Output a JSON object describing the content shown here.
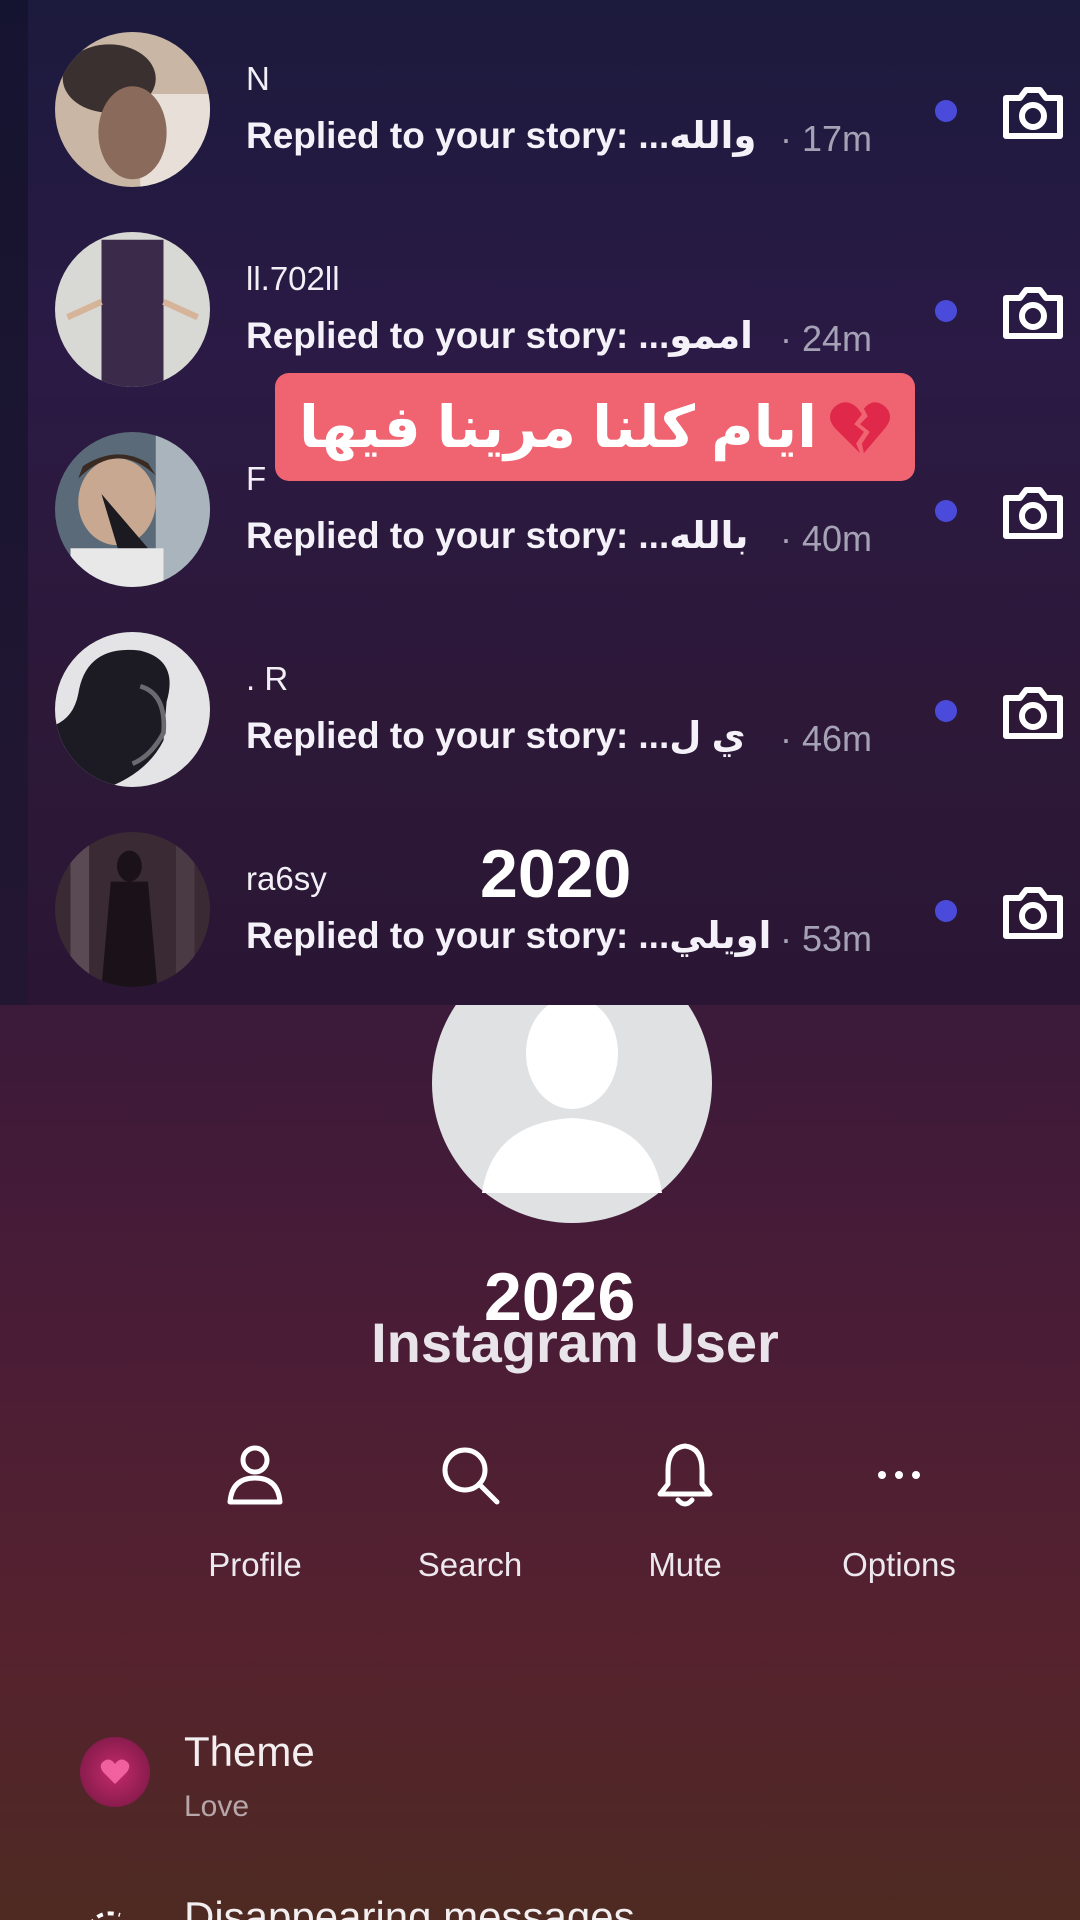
{
  "banner": {
    "text": "ايام كلنا مرينا فيها"
  },
  "year_top": "2020",
  "year_bottom": "2026",
  "threads": [
    {
      "name": "N",
      "preview_prefix": "Replied to your story:",
      "preview_text": "والله...",
      "time": "· 17m"
    },
    {
      "name": "ll.702ll",
      "preview_prefix": "Replied to your story:",
      "preview_text": "اممو...",
      "time": "· 24m"
    },
    {
      "name": "F",
      "preview_prefix": "Replied to your story:",
      "preview_text": "بالله...",
      "time": "· 40m"
    },
    {
      "name": ". R",
      "preview_prefix": "Replied to your story:",
      "preview_text": "ي ل...",
      "time": "· 46m"
    },
    {
      "name": "ra6sy",
      "preview_prefix": "Replied to your story:",
      "preview_text": "اويلي...",
      "time": "· 53m"
    }
  ],
  "profile": {
    "name": "Instagram User"
  },
  "actions": [
    {
      "label": "Profile",
      "icon": "person-icon"
    },
    {
      "label": "Search",
      "icon": "search-icon"
    },
    {
      "label": "Mute",
      "icon": "bell-icon"
    },
    {
      "label": "Options",
      "icon": "more-icon"
    }
  ],
  "settings": {
    "theme_label": "Theme",
    "theme_value": "Love",
    "disappearing_label": "Disappearing messages"
  },
  "colors": {
    "unread_dot": "#4a4bdb",
    "banner": "#ef6470"
  }
}
